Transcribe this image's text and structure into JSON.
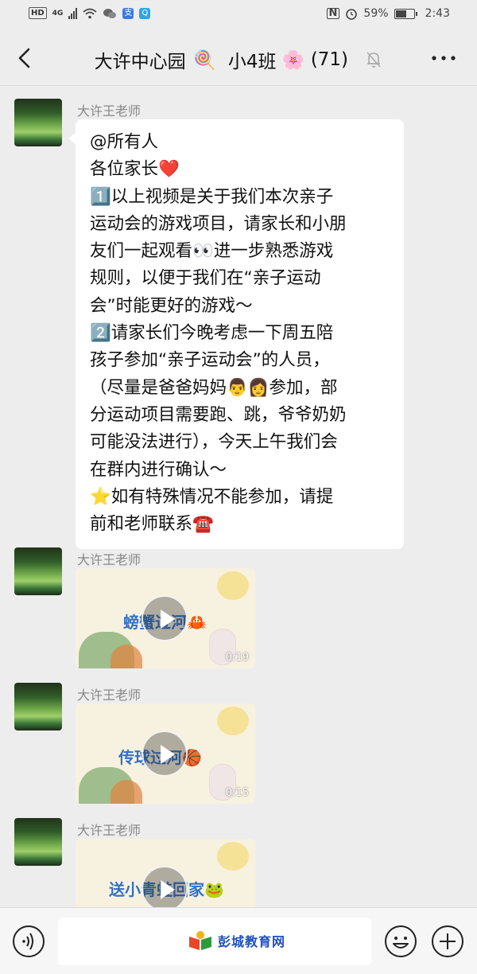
{
  "status_bar": {
    "left_badge": "HD",
    "network": "4G",
    "battery_text": "59%",
    "battery_level": 0.59,
    "time": "2:43"
  },
  "header": {
    "back_icon": "back-chevron-icon",
    "title_part1": "大许中心园",
    "title_emoji1": "🍭",
    "title_part2": "小4班",
    "title_emoji2": "🌸",
    "member_count": "(71)",
    "mute_icon": "bell-muted-icon",
    "more_icon": "more-dots-icon"
  },
  "messages": [
    {
      "sender": "大许王老师",
      "lines": [
        "@所有人",
        "各位家长❤️",
        "1️⃣以上视频是关于我们本次亲子",
        "运动会的游戏项目，请家长和小朋",
        "友们一起观看👀进一步熟悉游戏",
        "规则，以便于我们在“亲子运动",
        "会”时能更好的游戏～",
        "2️⃣请家长们今晚考虑一下周五陪",
        "孩子参加“亲子运动会”的人员，",
        "（尽量是爸爸妈妈👨👩参加，部",
        "分运动项目需要跑、跳，爷爷奶奶",
        "可能没法进行），今天上午我们会",
        "在群内进行确认～",
        "⭐如有特殊情况不能参加，请提",
        "前和老师联系☎️"
      ]
    },
    {
      "sender": "大许王老师",
      "video_title": "螃蟹过河🦀",
      "duration": "0:19"
    },
    {
      "sender": "大许王老师",
      "video_title": "传球过河🏀",
      "duration": "0:15"
    },
    {
      "sender": "大许王老师",
      "video_title": "送小青蛙回家🐸",
      "duration": ""
    }
  ],
  "input_bar": {
    "voice_icon": "voice-icon",
    "watermark": "彭城教育网",
    "emoji_icon": "emoji-icon",
    "plus_icon": "plus-icon"
  }
}
